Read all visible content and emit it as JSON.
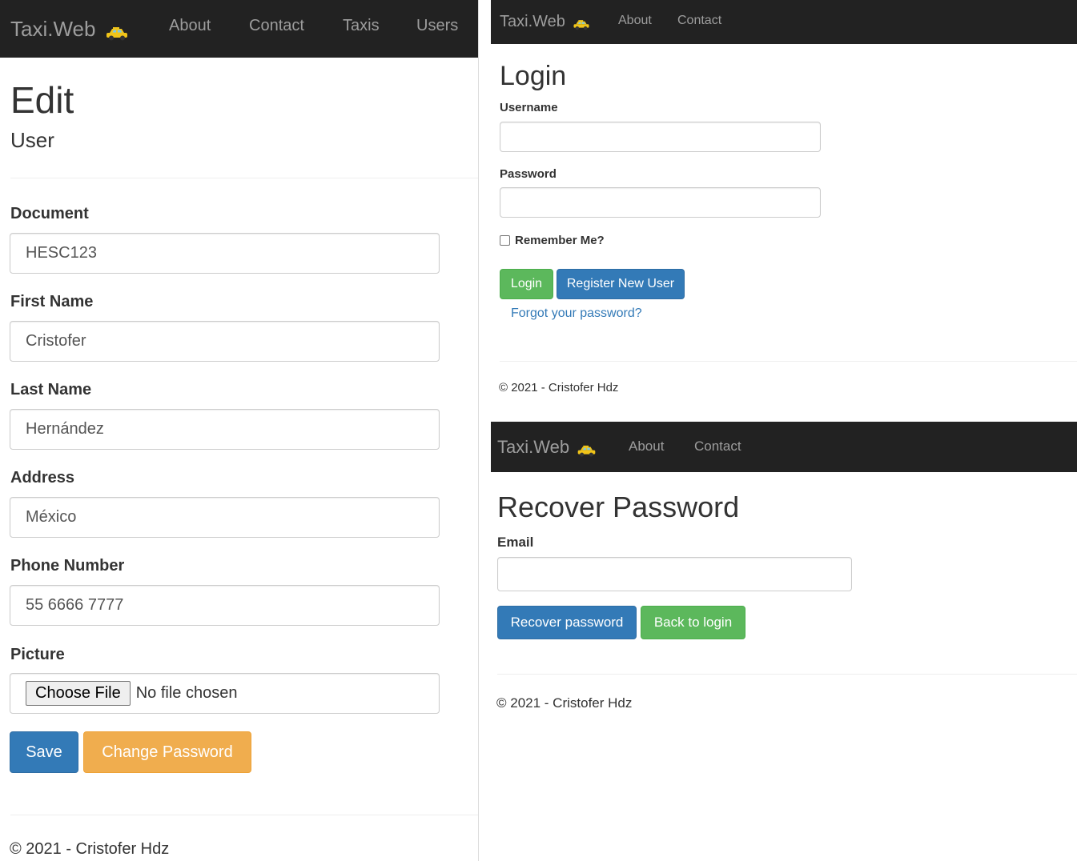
{
  "brand": {
    "name": "Taxi.Web",
    "icon": "taxi-icon",
    "icon_colors": {
      "body": "#f0c419",
      "window": "#7ec8e3",
      "wheel": "#333333"
    }
  },
  "colors": {
    "navbar": "#222222",
    "nav_text": "#9d9d9d",
    "primary": "#337ab7",
    "success": "#5cb85c",
    "warning": "#f0ad4e"
  },
  "edit_page": {
    "nav": {
      "about": "About",
      "contact": "Contact",
      "taxis": "Taxis",
      "users": "Users"
    },
    "title": "Edit",
    "subtitle": "User",
    "fields": {
      "document": {
        "label": "Document",
        "value": "HESC123"
      },
      "first_name": {
        "label": "First Name",
        "value": "Cristofer"
      },
      "last_name": {
        "label": "Last Name",
        "value": "Hernández"
      },
      "address": {
        "label": "Address",
        "value": "México"
      },
      "phone": {
        "label": "Phone Number",
        "value": "55 6666 7777"
      },
      "picture": {
        "label": "Picture",
        "button": "Choose File",
        "status": "No file chosen"
      }
    },
    "buttons": {
      "save": "Save",
      "change_password": "Change Password"
    },
    "footer": "© 2021 - Cristofer Hdz"
  },
  "login_page": {
    "nav": {
      "about": "About",
      "contact": "Contact"
    },
    "title": "Login",
    "username_label": "Username",
    "username_value": "",
    "password_label": "Password",
    "password_value": "",
    "remember_label": "Remember Me?",
    "remember_checked": false,
    "buttons": {
      "login": "Login",
      "register": "Register New User"
    },
    "forgot_link": "Forgot your password?",
    "footer": "© 2021 - Cristofer Hdz"
  },
  "recover_page": {
    "nav": {
      "about": "About",
      "contact": "Contact"
    },
    "title": "Recover Password",
    "email_label": "Email",
    "email_value": "",
    "buttons": {
      "recover": "Recover password",
      "back": "Back to login"
    },
    "footer": "© 2021 - Cristofer Hdz"
  }
}
